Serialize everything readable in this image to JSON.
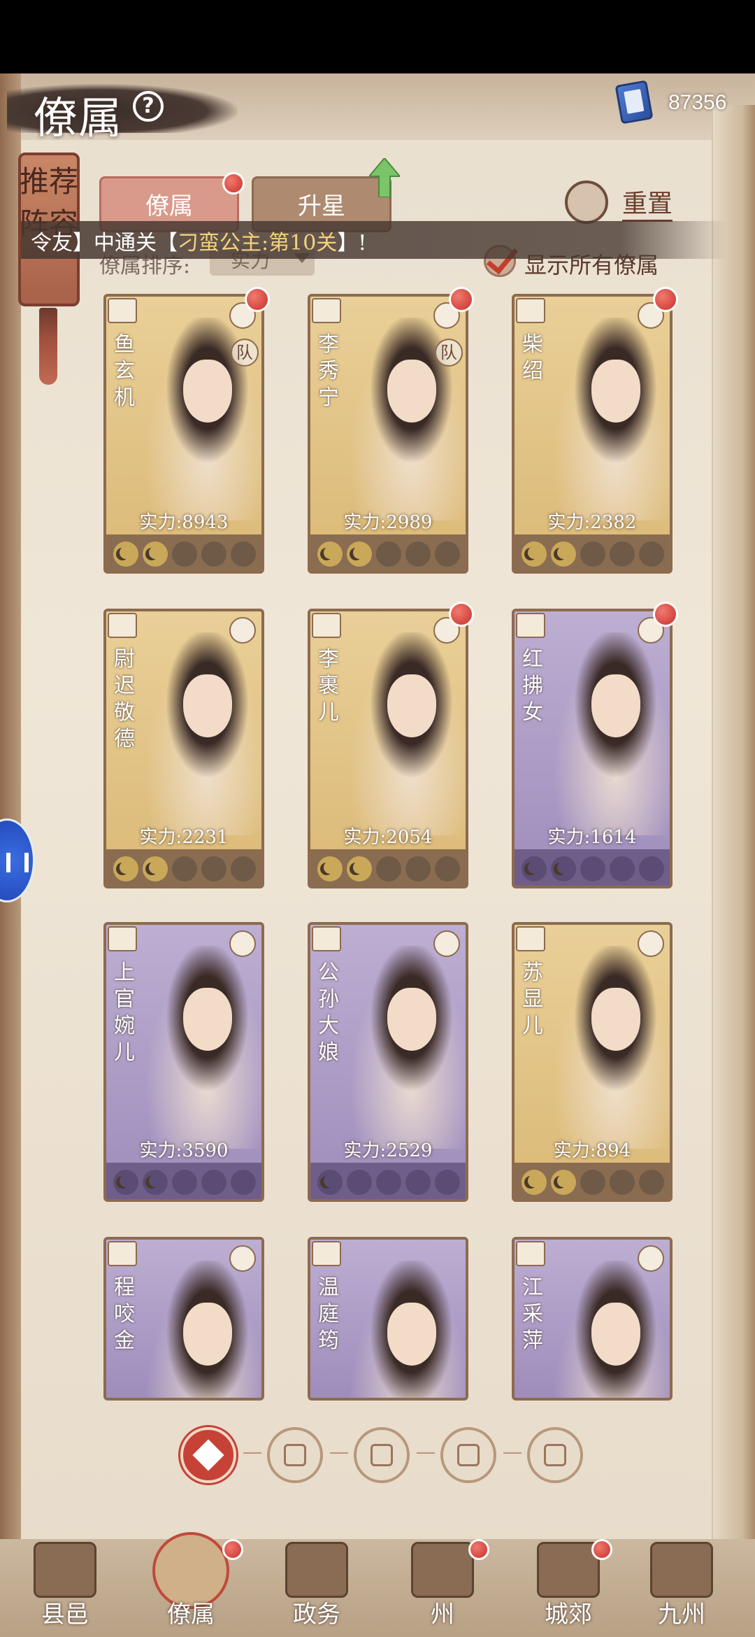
{
  "header": {
    "title": "僚属",
    "currency_value": "87356"
  },
  "side": {
    "recommend_label": "推荐阵容"
  },
  "tabs": [
    {
      "label": "僚属"
    },
    {
      "label": "升星"
    }
  ],
  "actions": {
    "reset_label": "重置"
  },
  "marquee": {
    "prefix": "令友】中通关【",
    "highlight": "刁蛮公主:第10关",
    "suffix": "】!"
  },
  "sort": {
    "label": "僚属排序:",
    "selected": "实力"
  },
  "show_all": {
    "label": "显示所有僚属",
    "checked": true
  },
  "cards": [
    {
      "name": "鱼玄机",
      "power_text": "实力:8943",
      "stars": 2,
      "frame": "gold",
      "team_icon": "队"
    },
    {
      "name": "李秀宁",
      "power_text": "实力:2989",
      "stars": 2,
      "frame": "gold",
      "team_icon": "队"
    },
    {
      "name": "柴绍",
      "power_text": "实力:2382",
      "stars": 2,
      "frame": "gold",
      "team_icon": ""
    },
    {
      "name": "尉迟敬德",
      "power_text": "实力:2231",
      "stars": 2,
      "frame": "gold",
      "team_icon": ""
    },
    {
      "name": "李裹儿",
      "power_text": "实力:2054",
      "stars": 2,
      "frame": "gold",
      "team_icon": ""
    },
    {
      "name": "红拂女",
      "power_text": "实力:1614",
      "stars": 2,
      "frame": "purple",
      "team_icon": ""
    },
    {
      "name": "上官婉儿",
      "power_text": "实力:3590",
      "stars": 2,
      "frame": "purple",
      "team_icon": ""
    },
    {
      "name": "公孙大娘",
      "power_text": "实力:2529",
      "stars": 1,
      "frame": "purple",
      "team_icon": ""
    },
    {
      "name": "苏显儿",
      "power_text": "实力:894",
      "stars": 2,
      "frame": "gold",
      "team_icon": ""
    },
    {
      "name": "程咬金",
      "power_text": "",
      "stars": 0,
      "frame": "purple",
      "team_icon": ""
    },
    {
      "name": "温庭筠",
      "power_text": "",
      "stars": 0,
      "frame": "purple",
      "team_icon": ""
    },
    {
      "name": "江采萍",
      "power_text": "",
      "stars": 0,
      "frame": "purple",
      "team_icon": ""
    }
  ],
  "nav": [
    {
      "label": "县邑"
    },
    {
      "label": "僚属"
    },
    {
      "label": "政务"
    },
    {
      "label": "州"
    },
    {
      "label": "城郊"
    },
    {
      "label": "九州"
    }
  ]
}
